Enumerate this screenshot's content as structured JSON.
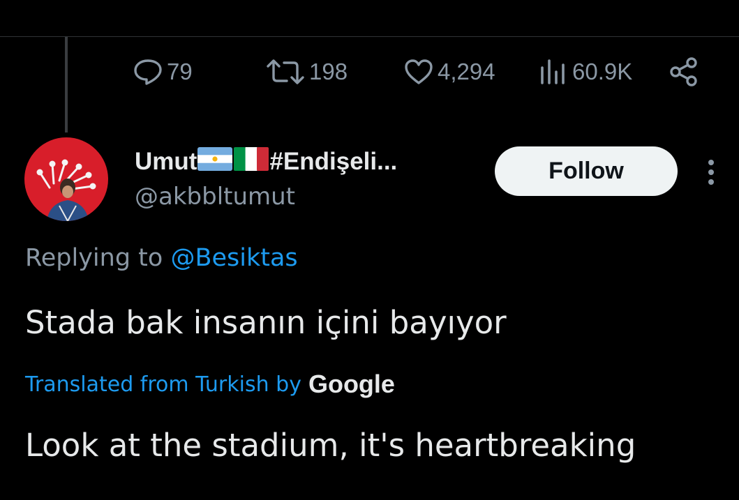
{
  "stats": {
    "replies": "79",
    "reposts": "198",
    "likes": "4,294",
    "views": "60.9K"
  },
  "icons": {
    "reply": "speech-bubble-icon",
    "repost": "repost-arrows-icon",
    "like": "heart-icon",
    "views": "bar-chart-icon",
    "share": "share-nodes-icon",
    "more": "vertical-ellipsis-icon"
  },
  "author": {
    "name": "Umut",
    "flags": [
      "🇦🇷",
      "🇮🇹"
    ],
    "name_suffix": "#Endişeli...",
    "handle": "@akbbltumut"
  },
  "follow_label": "Follow",
  "reply_context": {
    "prefix": "Replying to ",
    "mention": "@Besiktas"
  },
  "tweet_text": "Stada bak insanın içini bayıyor",
  "translation": {
    "label": "Translated from Turkish by",
    "provider": "Google",
    "text": "Look at the stadium, it's heartbreaking"
  },
  "colors": {
    "background": "#000000",
    "text": "#e7e9ea",
    "muted": "#8b98a5",
    "accent": "#1d9bf0",
    "avatar_bg": "#d81e2a",
    "follow_bg": "#eff3f4"
  }
}
